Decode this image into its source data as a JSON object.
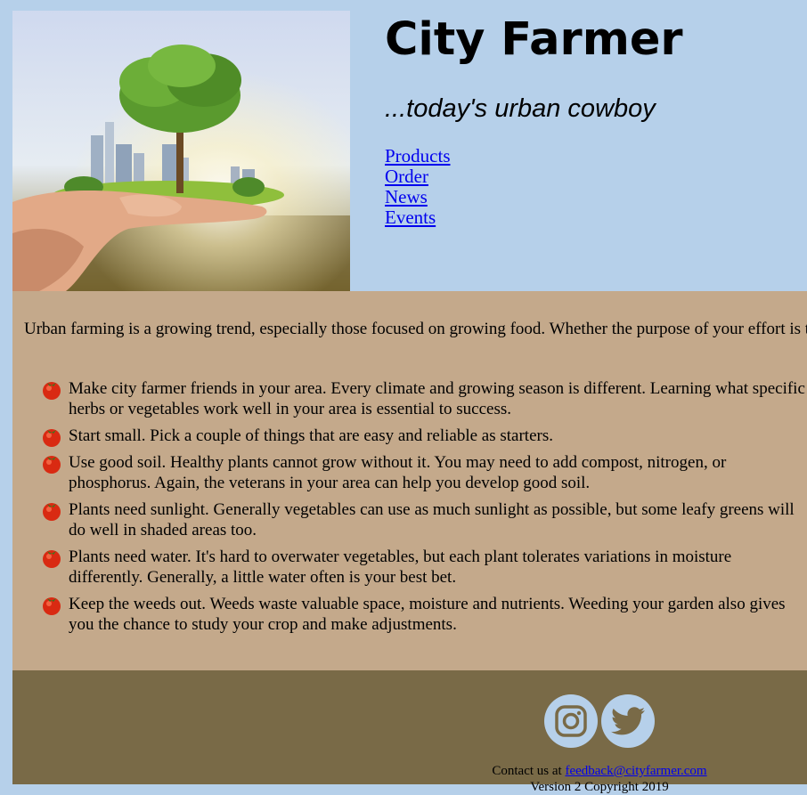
{
  "header": {
    "title": "City Farmer",
    "tagline": "...today's urban cowboy",
    "nav": [
      "Products",
      "Order",
      "News",
      "Events"
    ]
  },
  "main": {
    "intro": "Urban farming is a growing trend, especially those focused on growing food. Whether the purpose of your effort is to increase your self sufficiency, or even just because it is a rewarding and relaxing hobby, the following tips support you.",
    "tips": [
      "Make city farmer friends in your area. Every climate and growing season is different. Learning what specific herbs or vegetables work well in your area is essential to success.",
      "Start small. Pick a couple of things that are easy and reliable as starters.",
      "Use good soil. Healthy plants cannot grow without it. You may need to add compost, nitrogen, or phosphorus. Again, the veterans in your area can help you develop good soil.",
      "Plants need sunlight. Generally vegetables can use as much sunlight as possible, but some leafy greens will do well in shaded areas too.",
      "Plants need water. It's hard to overwater vegetables, but each plant tolerates variations in moisture differently. Generally, a little water often is your best bet.",
      "Keep the weeds out. Weeds waste valuable space, moisture and nutrients. Weeding your garden also gives you the chance to study your crop and make adjustments."
    ]
  },
  "footer": {
    "social": [
      "instagram-icon",
      "twitter-icon"
    ],
    "contact_prefix": "Contact us at ",
    "contact_email": "feedback@cityfarmer.com",
    "copyright": "Version 2 Copyright 2019"
  },
  "colors": {
    "header_bg": "#b6d0ea",
    "main_bg": "#c4a98b",
    "footer_bg": "#796a47",
    "link": "#0000ee"
  }
}
